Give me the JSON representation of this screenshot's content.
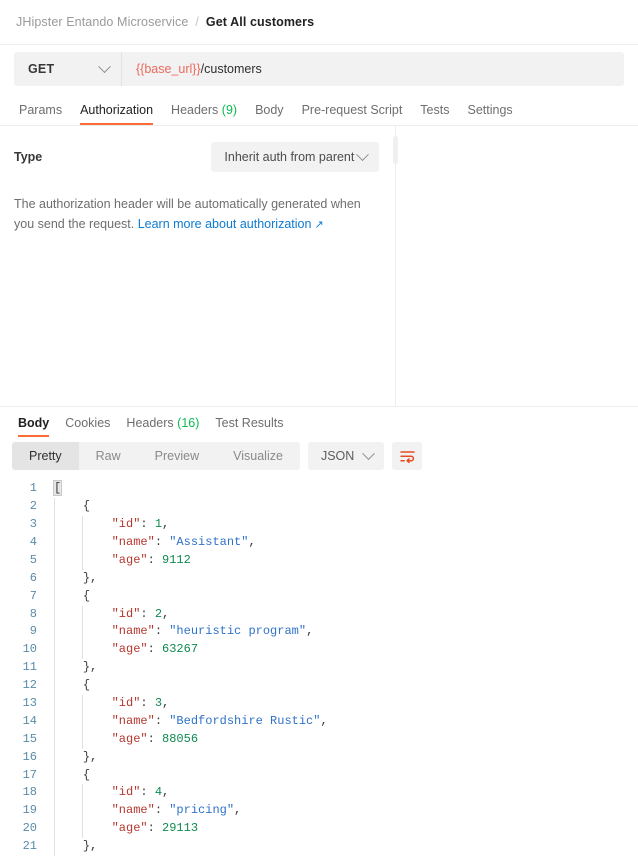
{
  "breadcrumb": {
    "collection": "JHipster Entando Microservice",
    "separator": "/",
    "current": "Get All customers"
  },
  "request": {
    "method": "GET",
    "url_variable": "{{base_url}}",
    "url_path": "/customers",
    "tabs": [
      {
        "label": "Params",
        "active": false,
        "count": ""
      },
      {
        "label": "Authorization",
        "active": true,
        "count": ""
      },
      {
        "label": "Headers",
        "active": false,
        "count": "(9)"
      },
      {
        "label": "Body",
        "active": false,
        "count": ""
      },
      {
        "label": "Pre-request Script",
        "active": false,
        "count": ""
      },
      {
        "label": "Tests",
        "active": false,
        "count": ""
      },
      {
        "label": "Settings",
        "active": false,
        "count": ""
      }
    ]
  },
  "authorization": {
    "type_label": "Type",
    "type_value": "Inherit auth from parent",
    "description_before": "The authorization header will be automatically generated when you send the request. ",
    "link_text": "Learn more about authorization",
    "link_arrow": "↗"
  },
  "response": {
    "tabs": [
      {
        "label": "Body",
        "active": true,
        "count": ""
      },
      {
        "label": "Cookies",
        "active": false,
        "count": ""
      },
      {
        "label": "Headers",
        "active": false,
        "count": "(16)"
      },
      {
        "label": "Test Results",
        "active": false,
        "count": ""
      }
    ],
    "view_modes": [
      {
        "label": "Pretty",
        "active": true
      },
      {
        "label": "Raw",
        "active": false
      },
      {
        "label": "Preview",
        "active": false
      },
      {
        "label": "Visualize",
        "active": false
      }
    ],
    "format": "JSON",
    "wrap_icon": "wrap-text-icon"
  },
  "body_json": {
    "language": "json",
    "lines": [
      {
        "n": 1,
        "indent": 0,
        "type": "open_array"
      },
      {
        "n": 2,
        "indent": 1,
        "type": "open_brace"
      },
      {
        "n": 3,
        "indent": 2,
        "type": "kv_num",
        "key": "id",
        "value": "1"
      },
      {
        "n": 4,
        "indent": 2,
        "type": "kv_str",
        "key": "name",
        "value": "Assistant"
      },
      {
        "n": 5,
        "indent": 2,
        "type": "kv_num_last",
        "key": "age",
        "value": "9112"
      },
      {
        "n": 6,
        "indent": 1,
        "type": "close_brace_comma"
      },
      {
        "n": 7,
        "indent": 1,
        "type": "open_brace"
      },
      {
        "n": 8,
        "indent": 2,
        "type": "kv_num",
        "key": "id",
        "value": "2"
      },
      {
        "n": 9,
        "indent": 2,
        "type": "kv_str",
        "key": "name",
        "value": "heuristic program"
      },
      {
        "n": 10,
        "indent": 2,
        "type": "kv_num_last",
        "key": "age",
        "value": "63267"
      },
      {
        "n": 11,
        "indent": 1,
        "type": "close_brace_comma"
      },
      {
        "n": 12,
        "indent": 1,
        "type": "open_brace"
      },
      {
        "n": 13,
        "indent": 2,
        "type": "kv_num",
        "key": "id",
        "value": "3"
      },
      {
        "n": 14,
        "indent": 2,
        "type": "kv_str",
        "key": "name",
        "value": "Bedfordshire Rustic"
      },
      {
        "n": 15,
        "indent": 2,
        "type": "kv_num_last",
        "key": "age",
        "value": "88056"
      },
      {
        "n": 16,
        "indent": 1,
        "type": "close_brace_comma"
      },
      {
        "n": 17,
        "indent": 1,
        "type": "open_brace"
      },
      {
        "n": 18,
        "indent": 2,
        "type": "kv_num",
        "key": "id",
        "value": "4"
      },
      {
        "n": 19,
        "indent": 2,
        "type": "kv_str",
        "key": "name",
        "value": "pricing"
      },
      {
        "n": 20,
        "indent": 2,
        "type": "kv_num_last",
        "key": "age",
        "value": "29113"
      },
      {
        "n": 21,
        "indent": 1,
        "type": "close_brace_comma"
      }
    ],
    "records": [
      {
        "id": 1,
        "name": "Assistant",
        "age": 9112
      },
      {
        "id": 2,
        "name": "heuristic program",
        "age": 63267
      },
      {
        "id": 3,
        "name": "Bedfordshire Rustic",
        "age": 88056
      },
      {
        "id": 4,
        "name": "pricing",
        "age": 29113
      }
    ]
  },
  "colors": {
    "accent": "#ff6c37",
    "link": "#0e7bd1",
    "count_green": "#0cbb52",
    "json_key": "#b5372f",
    "json_string": "#2f72c7",
    "json_number": "#0f8a4e",
    "line_number": "#5a8ca8",
    "variable_token": "#ec6a5e"
  }
}
